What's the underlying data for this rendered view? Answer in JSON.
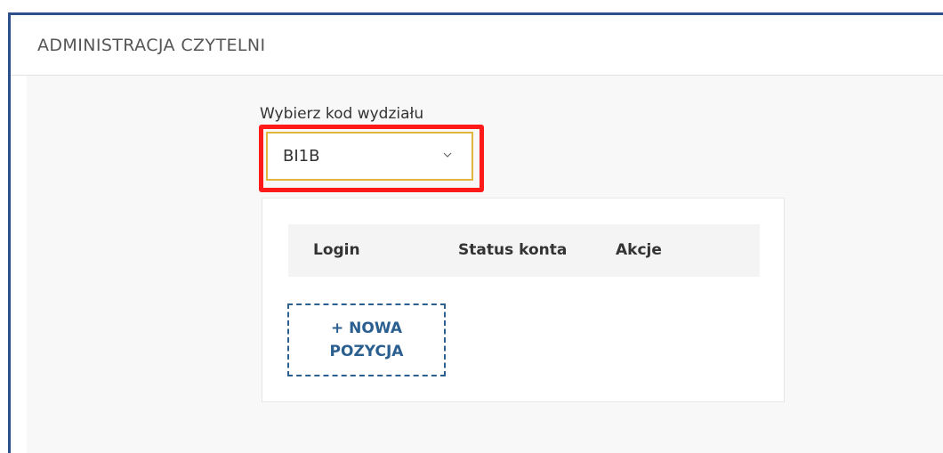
{
  "panel": {
    "title": "ADMINISTRACJA CZYTELNI"
  },
  "department_select": {
    "label": "Wybierz kod wydziału",
    "selected_value": "BI1B",
    "icon": "chevron-down-icon",
    "highlight_color": "#ff1a1a"
  },
  "table": {
    "columns": [
      "Login",
      "Status konta",
      "Akcje"
    ],
    "rows": []
  },
  "new_item_button": {
    "label": "+ NOWA POZYCJA"
  },
  "colors": {
    "accent": "#2b5f8f",
    "frame_border": "#2f4f8a",
    "select_border": "#e2b53d"
  }
}
